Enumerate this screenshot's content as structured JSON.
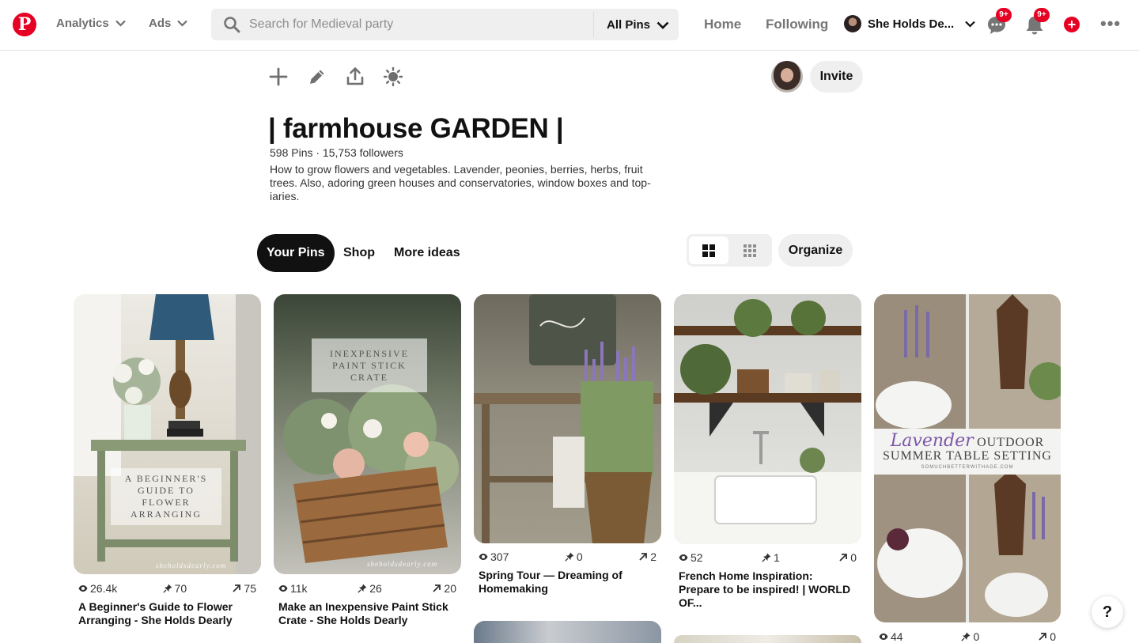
{
  "nav": {
    "logo_glyph": "P",
    "analytics_label": "Analytics",
    "ads_label": "Ads",
    "search_placeholder": "Search for Medieval party",
    "search_scope": "All Pins",
    "home_label": "Home",
    "following_label": "Following",
    "profile_name": "She Holds De...",
    "messages_badge": "9+",
    "notifications_badge": "9+",
    "more_glyph": "•••",
    "plus_glyph": "+"
  },
  "board": {
    "title": "| farmhouse GARDEN |",
    "stats": "598 Pins · 15,753 followers",
    "description": "How to grow flowers and vegetables. Lavender, peonies, berries, herbs, fruit trees. Also, adoring green houses and conservatories, window boxes and top-iaries.",
    "invite_label": "Invite"
  },
  "tabs": [
    {
      "label": "Your Pins",
      "active": true
    },
    {
      "label": "Shop",
      "active": false
    },
    {
      "label": "More ideas",
      "active": false
    }
  ],
  "organize_label": "Organize",
  "pins": [
    {
      "overlay": "A Beginner's Guide to Flower Arranging",
      "watermark": "sheholdsdearly.com",
      "views": "26.4k",
      "saves": "70",
      "clicks": "75",
      "title": "A Beginner's Guide to Flower Arranging - She Holds Dearly"
    },
    {
      "overlay": "Inexpensive Paint Stick Crate",
      "watermark": "sheholdsdearly.com",
      "views": "11k",
      "saves": "26",
      "clicks": "20",
      "title": "Make an Inexpensive Paint Stick Crate - She Holds Dearly"
    },
    {
      "overlay": "",
      "views": "307",
      "saves": "0",
      "clicks": "2",
      "title": "Spring Tour — Dreaming of Homemaking"
    },
    {
      "overlay": "",
      "views": "52",
      "saves": "1",
      "clicks": "0",
      "title": "French Home Inspiration: Prepare to be inspired! | WORLD OF..."
    },
    {
      "overlay_script": "Lavender",
      "overlay_caps": "Outdoor",
      "overlay_line2": "Summer Table Setting",
      "overlay_small": "SOMUCHBETTERWITHAGE.COM",
      "views": "44",
      "saves": "0",
      "clicks": "0",
      "title": ""
    }
  ],
  "help_label": "?",
  "colors": {
    "brand": "#e60023",
    "active_tab": "#111111",
    "chip": "#efefef"
  }
}
